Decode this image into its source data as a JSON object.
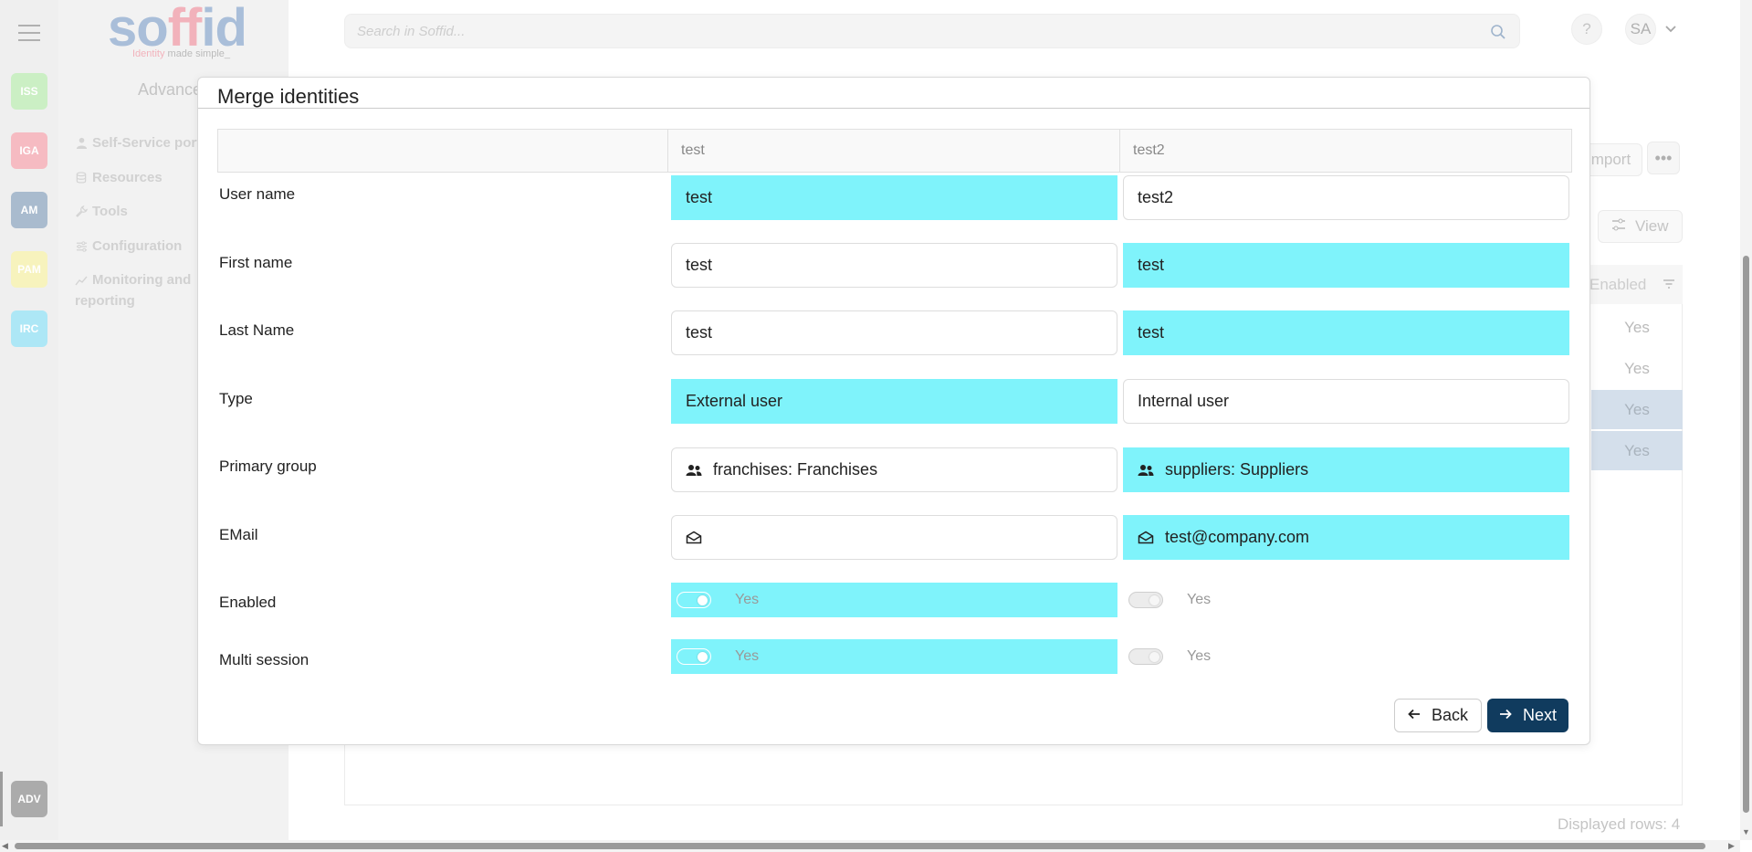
{
  "header": {
    "search_placeholder": "Search in Soffid...",
    "help_label": "?",
    "user_initials": "SA"
  },
  "logo": {
    "text_a": "so",
    "text_b": "ff",
    "text_c": "id",
    "tagline_a": "Identity",
    "tagline_b": " made simple_"
  },
  "apps": [
    {
      "label": "ISS",
      "color": "#a6e39a"
    },
    {
      "label": "IGA",
      "color": "#f08b96"
    },
    {
      "label": "AM",
      "color": "#6b8aab"
    },
    {
      "label": "PAM",
      "color": "#f1ea8e"
    },
    {
      "label": "IRC",
      "color": "#72d6f0"
    }
  ],
  "adv_app": {
    "label": "ADV"
  },
  "sidebar": {
    "section_title": "Advanced",
    "items": [
      {
        "label": "Self-Service portal",
        "icon": "user-icon"
      },
      {
        "label": "Resources",
        "icon": "database-icon"
      },
      {
        "label": "Tools",
        "icon": "wrench-icon"
      },
      {
        "label": "Configuration",
        "icon": "sliders-icon"
      },
      {
        "label": "Monitoring and",
        "label2": "reporting",
        "icon": "chart-line-icon"
      }
    ]
  },
  "background": {
    "import_label": "Import",
    "more_label": "•••",
    "view_label": "View",
    "column_header": "Enabled",
    "cells": [
      "Yes",
      "Yes",
      "Yes",
      "Yes"
    ],
    "footer": "Displayed rows: 4"
  },
  "dialog": {
    "title": "Merge identities",
    "columns": [
      "",
      "test",
      "test2"
    ],
    "rows": [
      {
        "label": "User name",
        "left": "test",
        "right": "test2",
        "selected": "left"
      },
      {
        "label": "First name",
        "left": "test",
        "right": "test",
        "selected": "right"
      },
      {
        "label": "Last Name",
        "left": "test",
        "right": "test",
        "selected": "right"
      },
      {
        "label": "Type",
        "left": "External user",
        "right": "Internal user",
        "selected": "left"
      },
      {
        "label": "Primary group",
        "left": "franchises: Franchises",
        "right": "suppliers: Suppliers",
        "selected": "right"
      },
      {
        "label": "EMail",
        "left": "",
        "right": "test@company.com",
        "selected": "right"
      },
      {
        "label": "Enabled",
        "left": "Yes",
        "right": "Yes",
        "selected": "left"
      },
      {
        "label": "Multi session",
        "left": "Yes",
        "right": "Yes",
        "selected": "left"
      }
    ],
    "back_label": "Back",
    "next_label": "Next"
  },
  "colors": {
    "highlight": "#7ff3fb",
    "primary_button": "#103b5e"
  }
}
